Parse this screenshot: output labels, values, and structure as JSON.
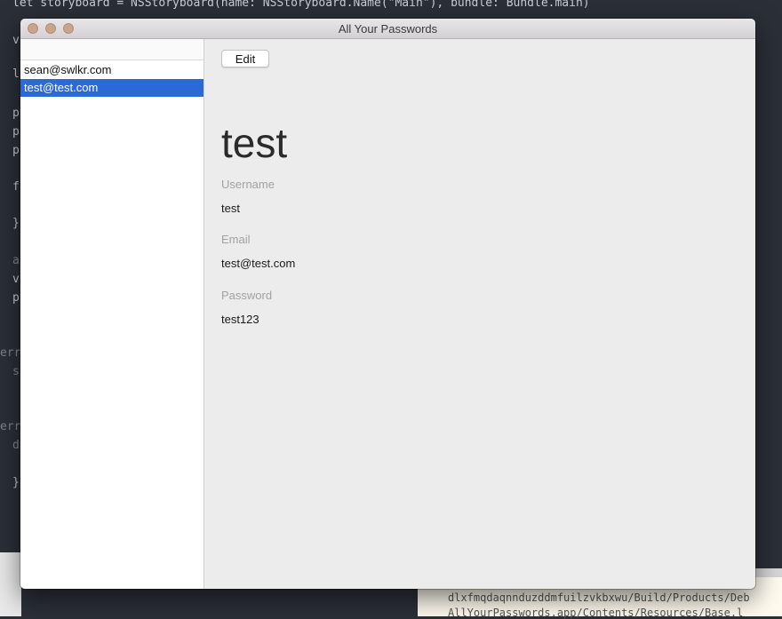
{
  "background": {
    "code_lines": [
      {
        "text": "let storyboard = NSStoryboard(name: NSStoryboard.Name(\"Main\"), bundle: Bundle.main)"
      },
      {
        "text": "v"
      },
      {
        "text": "l"
      },
      {
        "text": "p"
      },
      {
        "text": "p"
      },
      {
        "text": "p"
      },
      {
        "text": "f"
      },
      {
        "text": "}"
      },
      {
        "text": "a"
      },
      {
        "text": "v"
      },
      {
        "text": "p"
      },
      {
        "text": "err"
      },
      {
        "text": "s"
      },
      {
        "text": "err"
      },
      {
        "text": "d"
      },
      {
        "text": "}"
      }
    ],
    "output_lines": [
      "dlxfmqdaqnnduzddmfuilzvkbxwu/Build/Products/Deb",
      "AllYourPasswords.app/Contents/Resources/Base.l"
    ]
  },
  "window": {
    "title": "All Your Passwords",
    "sidebar": {
      "items": [
        {
          "label": "sean@swlkr.com",
          "selected": false
        },
        {
          "label": "test@test.com",
          "selected": true
        }
      ]
    },
    "detail": {
      "edit_label": "Edit",
      "title": "test",
      "fields": [
        {
          "label": "Username",
          "value": "test"
        },
        {
          "label": "Email",
          "value": "test@test.com"
        },
        {
          "label": "Password",
          "value": "test123"
        }
      ]
    }
  },
  "colors": {
    "selection": "#2a69d6",
    "editor_background": "#2b2f38",
    "window_background": "#ececec"
  }
}
